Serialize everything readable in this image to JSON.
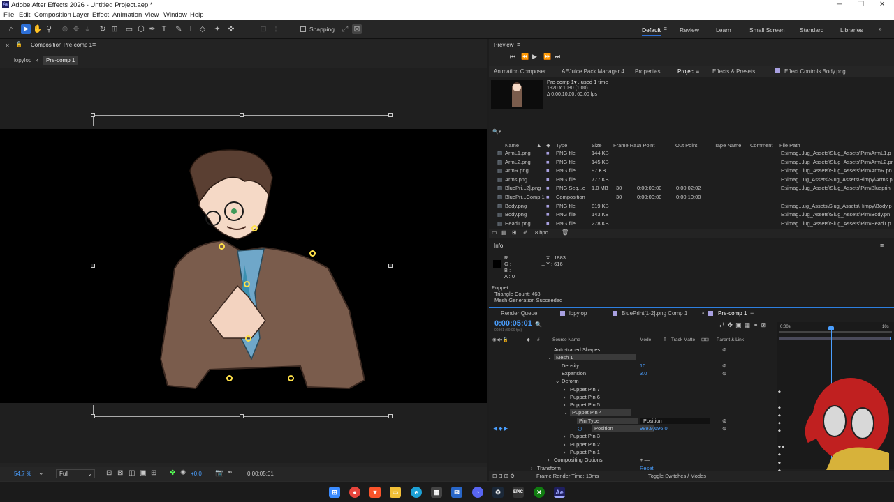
{
  "window": {
    "title": "Adobe After Effects 2026 - Untitled Project.aep *",
    "app_badge": "Ae",
    "minimize": "─",
    "maximize": "❐",
    "close": "✕"
  },
  "menu": [
    "File",
    "Edit",
    "Composition",
    "Layer",
    "Effect",
    "Animation",
    "View",
    "Window",
    "Help"
  ],
  "toolbar": {
    "snapping": "Snapping"
  },
  "workspaces": [
    "Default",
    "Review",
    "Learn",
    "Small Screen",
    "Standard",
    "Libraries"
  ],
  "comp_panel": {
    "title": "Composition Pre-comp 1",
    "crumbs": [
      "lopylop",
      "Pre-comp 1"
    ],
    "zoom": "54.7 %",
    "resolution": "Full",
    "exposure": "+0.0",
    "timecode": "0:00:05:01"
  },
  "preview": {
    "title": "Preview"
  },
  "project_tabs": [
    "Animation Composer",
    "AEJuice Pack Manager 4",
    "Properties",
    "Project",
    "Effects & Presets",
    "Effect Controls Body.png"
  ],
  "project": {
    "item_name": "Pre-comp 1▾ , used 1 time",
    "item_size": "1920 x 1080 (1.00)",
    "item_duration": "Δ 0:00:10:00, 60.00 fps",
    "search_placeholder": "🔍▾",
    "bpc": "8 bpc",
    "columns": [
      "Name",
      "Type",
      "Size",
      "Frame Ra...",
      "In Point",
      "Out Point",
      "Tape Name",
      "Comment",
      "File Path"
    ],
    "rows": [
      {
        "name": "ArmL1.png",
        "type": "PNG file",
        "size": "144 KB",
        "fr": "",
        "in": "",
        "out": "",
        "path": "E:\\imag...lug_Assets\\Slug_Assets\\Pim\\ArmL1.p"
      },
      {
        "name": "ArmL2.png",
        "type": "PNG file",
        "size": "145 KB",
        "fr": "",
        "in": "",
        "out": "",
        "path": "E:\\imag...lug_Assets\\Slug_Assets\\Pim\\ArmL2.png"
      },
      {
        "name": "ArmR.png",
        "type": "PNG file",
        "size": "97 KB",
        "fr": "",
        "in": "",
        "out": "",
        "path": "E:\\imag...lug_Assets\\Slug_Assets\\Pim\\ArmR.pn"
      },
      {
        "name": "Arms.png",
        "type": "PNG file",
        "size": "777 KB",
        "fr": "",
        "in": "",
        "out": "",
        "path": "E:\\imag...ug_Assets\\Slug_Assets\\Himpy\\Arms.p"
      },
      {
        "name": "BluePri...2].png",
        "type": "PNG Seq...e",
        "size": "1.0 MB",
        "fr": "30",
        "in": "0:00:00:00",
        "out": "0:00:02:02",
        "path": "E:\\imag...lug_Assets\\Slug_Assets\\Pim\\Blueprin"
      },
      {
        "name": "BluePri...Comp 1",
        "type": "Composition",
        "size": "",
        "fr": "30",
        "in": "0:00:00:00",
        "out": "0:00:10:00",
        "path": ""
      },
      {
        "name": "Body.png",
        "type": "PNG file",
        "size": "819 KB",
        "fr": "",
        "in": "",
        "out": "",
        "path": "E:\\imag...ug_Assets\\Slug_Assets\\Himpy\\Body.p"
      },
      {
        "name": "Body.png",
        "type": "PNG file",
        "size": "143 KB",
        "fr": "",
        "in": "",
        "out": "",
        "path": "E:\\imag...lug_Assets\\Slug_Assets\\Pim\\Body.pn"
      },
      {
        "name": "Head1.png",
        "type": "PNG file",
        "size": "278 KB",
        "fr": "",
        "in": "",
        "out": "",
        "path": "E:\\imag...lug_Assets\\Slug_Assets\\Pim\\Head1.p"
      }
    ]
  },
  "info": {
    "title": "Info",
    "r": "R :",
    "g": "G :",
    "b": "B :",
    "a": "A : 0",
    "x": "X : 1883",
    "y": "Y : 616",
    "tool": "Puppet",
    "triangles": "Triangle Count: 468",
    "mesh": "Mesh Generation Succeeded"
  },
  "timeline": {
    "tabs": [
      "Render Queue",
      "lopylop",
      "BluePrint[1-2].png Comp 1",
      "Pre-comp 1"
    ],
    "time": "0:00:05:01",
    "frames": "00301 (60.00 fps)",
    "col_source": "Source Name",
    "col_mode": "Mode",
    "col_t": "T",
    "col_matte": "Track Matte",
    "col_parent": "Parent & Link",
    "ruler": [
      "0:00s",
      "10s"
    ],
    "layers": [
      {
        "label": "Auto-traced Shapes",
        "indent": 0,
        "value": ""
      },
      {
        "label": "Mesh 1",
        "indent": 0,
        "value": ""
      },
      {
        "label": "Density",
        "indent": 1,
        "value": "10"
      },
      {
        "label": "Expansion",
        "indent": 1,
        "value": "3.0"
      },
      {
        "label": "Deform",
        "indent": 1,
        "value": ""
      },
      {
        "label": "Puppet Pin 7",
        "indent": 2,
        "value": ""
      },
      {
        "label": "Puppet Pin 6",
        "indent": 2,
        "value": ""
      },
      {
        "label": "Puppet Pin 5",
        "indent": 2,
        "value": ""
      },
      {
        "label": "Puppet Pin 4",
        "indent": 2,
        "value": ""
      },
      {
        "label": "Pin Type",
        "indent": 3,
        "value": "Position"
      },
      {
        "label": "Position",
        "indent": 3,
        "value": "989.9,696.0"
      },
      {
        "label": "Puppet Pin 3",
        "indent": 2,
        "value": ""
      },
      {
        "label": "Puppet Pin 2",
        "indent": 2,
        "value": ""
      },
      {
        "label": "Puppet Pin 1",
        "indent": 2,
        "value": ""
      },
      {
        "label": "Compositing Options",
        "indent": 0,
        "value": "+ —"
      },
      {
        "label": "Transform",
        "indent": -1,
        "value": "Reset"
      }
    ],
    "render_time": "Frame Render Time: 13ms",
    "toggle": "Toggle Switches / Modes"
  },
  "taskbar": [
    "Windows",
    "Chrome",
    "Brave",
    "Explorer",
    "Edge",
    "Store",
    "Mail",
    "Discord",
    "Steam",
    "Epic",
    "Xbox",
    "Ae"
  ],
  "colors": {
    "accent": "#2d6fd6",
    "pin": "#ffe14a",
    "blue_time": "#4a9fff"
  }
}
